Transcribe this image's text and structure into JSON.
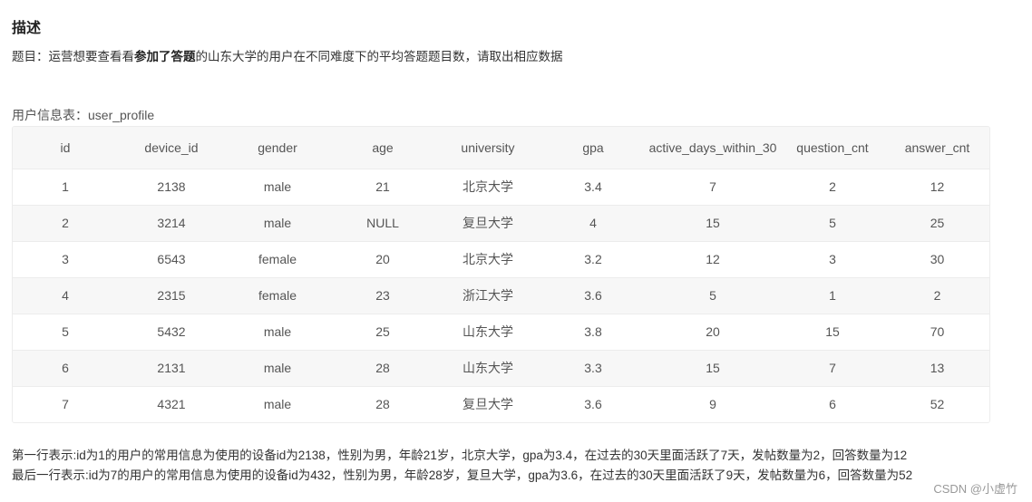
{
  "heading": "描述",
  "question": {
    "prefix": "题目：运营想要查看看",
    "emphasis": "参加了答题",
    "suffix": "的山东大学的用户在不同难度下的平均答题题目数，请取出相应数据"
  },
  "table": {
    "caption": "用户信息表：user_profile",
    "columns": [
      "id",
      "device_id",
      "gender",
      "age",
      "university",
      "gpa",
      "active_days_within_30",
      "question_cnt",
      "answer_cnt"
    ],
    "rows": [
      [
        "1",
        "2138",
        "male",
        "21",
        "北京大学",
        "3.4",
        "7",
        "2",
        "12"
      ],
      [
        "2",
        "3214",
        "male",
        "NULL",
        "复旦大学",
        "4",
        "15",
        "5",
        "25"
      ],
      [
        "3",
        "6543",
        "female",
        "20",
        "北京大学",
        "3.2",
        "12",
        "3",
        "30"
      ],
      [
        "4",
        "2315",
        "female",
        "23",
        "浙江大学",
        "3.6",
        "5",
        "1",
        "2"
      ],
      [
        "5",
        "5432",
        "male",
        "25",
        "山东大学",
        "3.8",
        "20",
        "15",
        "70"
      ],
      [
        "6",
        "2131",
        "male",
        "28",
        "山东大学",
        "3.3",
        "15",
        "7",
        "13"
      ],
      [
        "7",
        "4321",
        "male",
        "28",
        "复旦大学",
        "3.6",
        "9",
        "6",
        "52"
      ]
    ]
  },
  "notes": [
    "第一行表示:id为1的用户的常用信息为使用的设备id为2138，性别为男，年龄21岁，北京大学，gpa为3.4，在过去的30天里面活跃了7天，发帖数量为2，回答数量为12",
    "最后一行表示:id为7的用户的常用信息为使用的设备id为432，性别为男，年龄28岁，复旦大学，gpa为3.6，在过去的30天里面活跃了9天，发帖数量为6，回答数量为52"
  ],
  "watermark": "CSDN @小虚竹"
}
